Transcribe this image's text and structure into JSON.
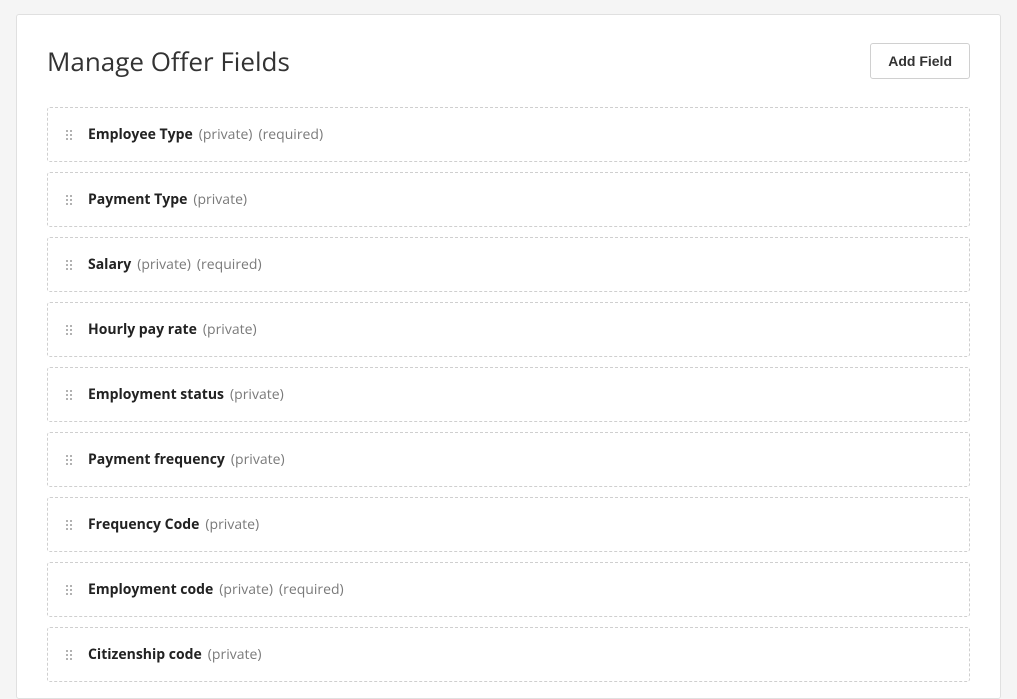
{
  "header": {
    "title": "Manage Offer Fields",
    "add_button_label": "Add Field"
  },
  "tags": {
    "private": "(private)",
    "required": "(required)"
  },
  "fields": [
    {
      "name": "Employee Type",
      "private": true,
      "required": true
    },
    {
      "name": "Payment Type",
      "private": true,
      "required": false
    },
    {
      "name": "Salary",
      "private": true,
      "required": true
    },
    {
      "name": "Hourly pay rate",
      "private": true,
      "required": false
    },
    {
      "name": "Employment status",
      "private": true,
      "required": false
    },
    {
      "name": "Payment frequency",
      "private": true,
      "required": false
    },
    {
      "name": "Frequency Code",
      "private": true,
      "required": false
    },
    {
      "name": "Employment code",
      "private": true,
      "required": true
    },
    {
      "name": "Citizenship code",
      "private": true,
      "required": false
    }
  ]
}
